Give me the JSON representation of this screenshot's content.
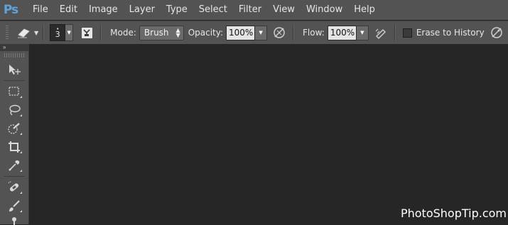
{
  "app": {
    "logo_text": "Ps"
  },
  "menu": [
    "File",
    "Edit",
    "Image",
    "Layer",
    "Type",
    "Select",
    "Filter",
    "View",
    "Window",
    "Help"
  ],
  "options": {
    "brush_size": "3",
    "mode_label": "Mode:",
    "mode_value": "Brush",
    "opacity_label": "Opacity:",
    "opacity_value": "100%",
    "flow_label": "Flow:",
    "flow_value": "100%",
    "erase_history_label": "Erase to History",
    "erase_history_checked": false
  },
  "toolbar": {
    "collapse_label": "»",
    "tools": [
      "move-tool-icon",
      "rectangular-marquee-tool-icon",
      "lasso-tool-icon",
      "quick-selection-tool-icon",
      "crop-tool-icon",
      "eyedropper-tool-icon",
      "spot-healing-brush-icon",
      "brush-tool-icon",
      "clone-stamp-tool-icon"
    ]
  },
  "watermark": "PhotoShopTip.com",
  "colors": {
    "menubar": "#535353",
    "workspace": "#262626",
    "logo": "#5fa3d8"
  }
}
